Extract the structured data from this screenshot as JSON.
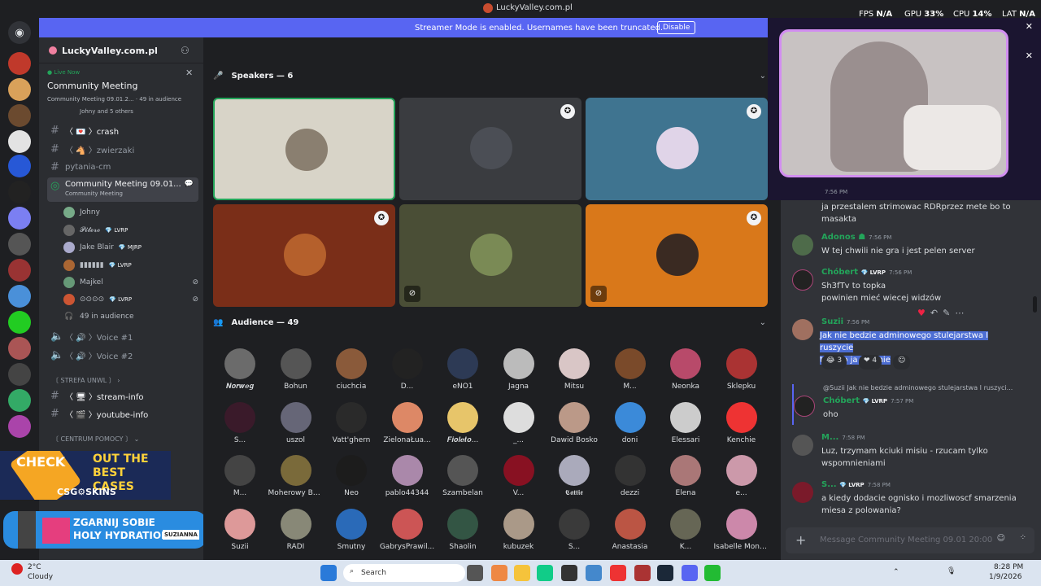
{
  "window_title": "LuckyValley.com.pl",
  "overlay": {
    "fps_label": "FPS",
    "fps": "N/A",
    "gpu_label": "GPU",
    "gpu": "33%",
    "cpu_label": "CPU",
    "cpu": "14%",
    "lat_label": "LAT",
    "lat": "N/A"
  },
  "banner": {
    "text": "Streamer Mode is enabled. Usernames have been truncated.",
    "button": "Disable"
  },
  "server": {
    "name": "LuckyValley.com.pl"
  },
  "live": {
    "status": "Live Now",
    "title": "Community Meeting",
    "meta": "Community Meeting 09.01.2...",
    "audience": "49 in audience",
    "people": "Johny and 5 others"
  },
  "channels": [
    {
      "icon": "#",
      "label": "〈 💌 〉crash",
      "active": false
    },
    {
      "icon": "#",
      "label": "〈 🐴 〉zwierzaki",
      "active": false
    },
    {
      "icon": "#",
      "label": "pytania-cm",
      "active": false
    },
    {
      "icon": "◎",
      "label": "Community Meeting 09.01...",
      "active": true,
      "sub": "Community Meeting"
    }
  ],
  "stage_members": [
    {
      "name": "Johny",
      "badge": ""
    },
    {
      "name": "𝓟𝓲𝓽𝓮𝓻𝓸",
      "badge": "LVRP"
    },
    {
      "name": "Jake Blair",
      "badge": "MJRP"
    },
    {
      "name": "▮▮▮▮▮▮",
      "badge": "LVRP"
    },
    {
      "name": "Majkel",
      "badge": ""
    },
    {
      "name": "⊙⊙⊙⊙",
      "badge": "LVRP"
    }
  ],
  "stage_audience": "49 in audience",
  "voice_channels": [
    "〈 🔊 〉Voice #1",
    "〈 🔊 〉Voice #2"
  ],
  "category1": "〔 STREFA UNWL 〕",
  "channels2": [
    "〈 🖥 〉stream-info",
    "〈 🎬 〉youtube-info"
  ],
  "category2": "〔 CENTRUM POMOCY 〕",
  "ads": {
    "top_line1": "CHECK",
    "top_line2": "OUT THE BEST CASES",
    "top_logo": "CSG⚙SKINS",
    "bottom_line1": "ZGARNIJ SOBIE",
    "bottom_line2": "HOLY HYDRATION",
    "bottom_tag": "SUZIANNA"
  },
  "speakers_header": "Speakers — 6",
  "audience_header": "Audience — 49",
  "audience": [
    "𝑵𝒐𝒓𝒘𝒆𝒈",
    "Bohun",
    "ciuchcia",
    "D...",
    "eNO1",
    "Jagna",
    "Mitsu",
    "M...",
    "Neonka",
    "Sklepku",
    "S...",
    "uszol",
    "Vatt'ghern",
    "ZielonaŁua...",
    "𝑭𝒊𝒐𝒍𝒆𝒕𝒐...",
    "_...",
    "Dawid Bosko",
    "doni",
    "Elessari",
    "Kenchie",
    "M...",
    "Moherowy Be...",
    "Neo",
    "pablo44344",
    "Szambelan",
    "V...",
    "𝕮𝖆𝖙𝖙𝖎𝖊",
    "dezzi",
    "Elena",
    "e...",
    "Suzii",
    "RADI",
    "Smutny",
    "GabrysPrawil...",
    "Shaolin",
    "kubuzek",
    "S...",
    "Anastasia",
    "K...",
    "Isabelle Monti..."
  ],
  "chat": [
    {
      "user": "",
      "time": "7:56 PM",
      "lines": [
        "ja przestalem strimowac RDRprzez mete bo to",
        "masakta"
      ]
    },
    {
      "user": "Adonos",
      "time": "7:56 PM",
      "lines": [
        "W tej chwili nie gra i jest pelen server"
      ]
    },
    {
      "user": "Chóbert",
      "badge": "LVRP",
      "time": "7:56 PM",
      "lines": [
        "Sh3fTv to topka",
        "powinien mieć wiecej widzów"
      ]
    },
    {
      "user": "Suzii",
      "time": "7:56 PM",
      "lines": [
        "Jak nie bedzie adminowego stulejarstwa I ruszycie",
        "tylki to ja chetnie"
      ],
      "reactions": [
        "😂 3",
        "❤ 4"
      ]
    },
    {
      "user": "Chóbert",
      "badge": "LVRP",
      "time": "7:57 PM",
      "reply": "@Suzii Jak nie bedzie adminowego stulejarstwa I ruszyci...",
      "lines": [
        "oho"
      ]
    },
    {
      "user": "M...",
      "time": "7:58 PM",
      "lines": [
        "Luz, trzymam kciuki misiu - rzucam tylko",
        "wspomnieniami"
      ]
    },
    {
      "user": "S...",
      "badge": "LVRP",
      "time": "7:58 PM",
      "lines": [
        "a kiedy dodacie ognisko i mozliwoscf smarzenia",
        "miesa z polowania?"
      ]
    }
  ],
  "input_placeholder": "Message Community Meeting 09.01 20:00",
  "taskbar": {
    "weather_temp": "2°C",
    "weather_desc": "Cloudy",
    "search": "Search",
    "time": "8:28 PM",
    "date": "1/9/2026"
  }
}
